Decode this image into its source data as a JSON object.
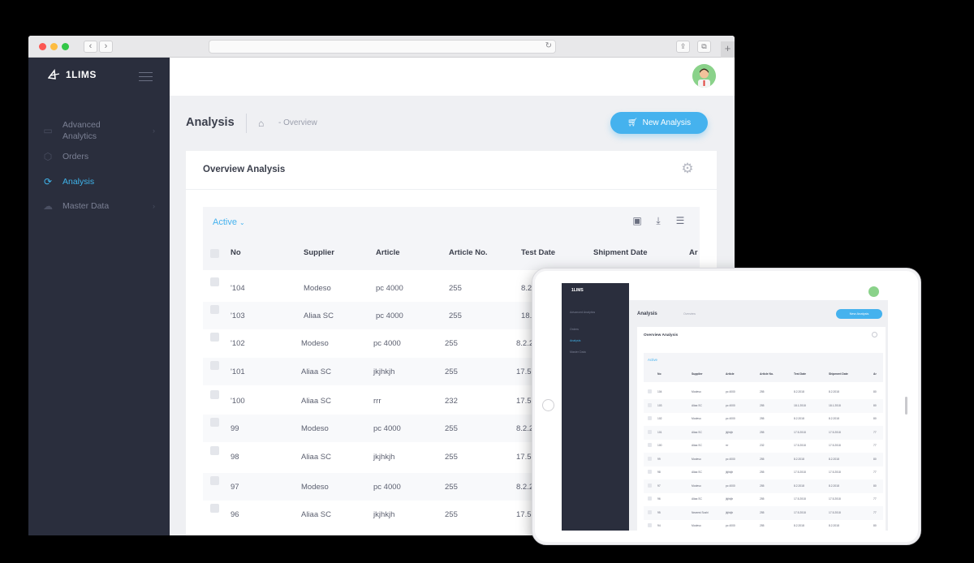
{
  "app": {
    "name": "1LIMS"
  },
  "sidebar": {
    "items": [
      {
        "label": "Advanced Analytics",
        "icon": "chart-icon",
        "has_children": true
      },
      {
        "label": "Orders",
        "icon": "box-icon",
        "has_children": false
      },
      {
        "label": "Analysis",
        "icon": "refresh-icon",
        "has_children": false,
        "active": true
      },
      {
        "label": "Master Data",
        "icon": "cloud-icon",
        "has_children": true
      }
    ]
  },
  "header": {
    "title": "Analysis",
    "breadcrumb": "- Overview",
    "new_button": "New Analysis"
  },
  "card": {
    "title": "Overview Analysis",
    "filter": "Active"
  },
  "table": {
    "columns": [
      "No",
      "Supplier",
      "Article",
      "Article No.",
      "Test Date",
      "Shipment Date",
      "Ar"
    ],
    "rows": [
      {
        "no": "'104",
        "supplier": "Modeso",
        "article": "pc 4000",
        "article_no": "255",
        "test_date": "8.2"
      },
      {
        "no": "'103",
        "supplier": "Aliaa SC",
        "article": "pc 4000",
        "article_no": "255",
        "test_date": "18.1"
      },
      {
        "no": "'102",
        "supplier": "Modeso",
        "article": "pc 4000",
        "article_no": "255",
        "test_date": "8.2.2"
      },
      {
        "no": "'101",
        "supplier": "Aliaa SC",
        "article": "jkjhkjh",
        "article_no": "255",
        "test_date": "17.5.2"
      },
      {
        "no": "'100",
        "supplier": "Aliaa SC",
        "article": "rrr",
        "article_no": "232",
        "test_date": "17.5.2"
      },
      {
        "no": "99",
        "supplier": "Modeso",
        "article": "pc 4000",
        "article_no": "255",
        "test_date": "8.2.2"
      },
      {
        "no": "98",
        "supplier": "Aliaa SC",
        "article": "jkjhkjh",
        "article_no": "255",
        "test_date": "17.5.2"
      },
      {
        "no": "97",
        "supplier": "Modeso",
        "article": "pc 4000",
        "article_no": "255",
        "test_date": "8.2.2"
      },
      {
        "no": "96",
        "supplier": "Aliaa SC",
        "article": "jkjhkjh",
        "article_no": "255",
        "test_date": "17.5.2"
      }
    ]
  },
  "tablet": {
    "app_name": "1LIMS",
    "sidebar_items": [
      "Advanced Analytics",
      "Orders",
      "Analysis",
      "Master Data"
    ],
    "title": "Analysis",
    "breadcrumb": "Overview",
    "new_button": "New Analysis",
    "card_title": "Overview Analysis",
    "filter": "Active",
    "columns": [
      "No",
      "Supplier",
      "Article",
      "Article No.",
      "Test Date",
      "Shipment Date",
      "Ar"
    ],
    "rows": [
      [
        "104",
        "Modeso",
        "pc 4000",
        "255",
        "8.2.2018",
        "8.2.2018",
        "80"
      ],
      [
        "103",
        "Aliaa SC",
        "pc 4000",
        "255",
        "18.1.2018",
        "18.1.2018",
        "80"
      ],
      [
        "102",
        "Modeso",
        "pc 4000",
        "255",
        "8.2.2018",
        "8.2.2018",
        "80"
      ],
      [
        "101",
        "Aliaa SC",
        "jkjhkjh",
        "255",
        "17.5.2018",
        "17.5.2018",
        "77"
      ],
      [
        "100",
        "Aliaa SC",
        "rrr",
        "232",
        "17.5.2018",
        "17.5.2018",
        "77"
      ],
      [
        "99",
        "Modeso",
        "pc 4000",
        "255",
        "8.2.2018",
        "8.2.2018",
        "80"
      ],
      [
        "98",
        "Aliaa SC",
        "jkjhkjh",
        "255",
        "17.5.2018",
        "17.5.2018",
        "77"
      ],
      [
        "97",
        "Modeso",
        "pc 4000",
        "255",
        "8.2.2018",
        "8.2.2018",
        "80"
      ],
      [
        "96",
        "Aliaa SC",
        "jkjhkjh",
        "255",
        "17.5.2018",
        "17.5.2018",
        "77"
      ],
      [
        "95",
        "Nearest Sushi",
        "jkjhkjh",
        "255",
        "17.5.2018",
        "17.5.2018",
        "77"
      ],
      [
        "94",
        "Modeso",
        "pc 4000",
        "255",
        "8.2.2018",
        "8.2.2018",
        "80"
      ]
    ]
  },
  "colors": {
    "accent": "#45b2ee",
    "sidebar": "#2a2e3d",
    "page_bg": "#eff0f3"
  }
}
